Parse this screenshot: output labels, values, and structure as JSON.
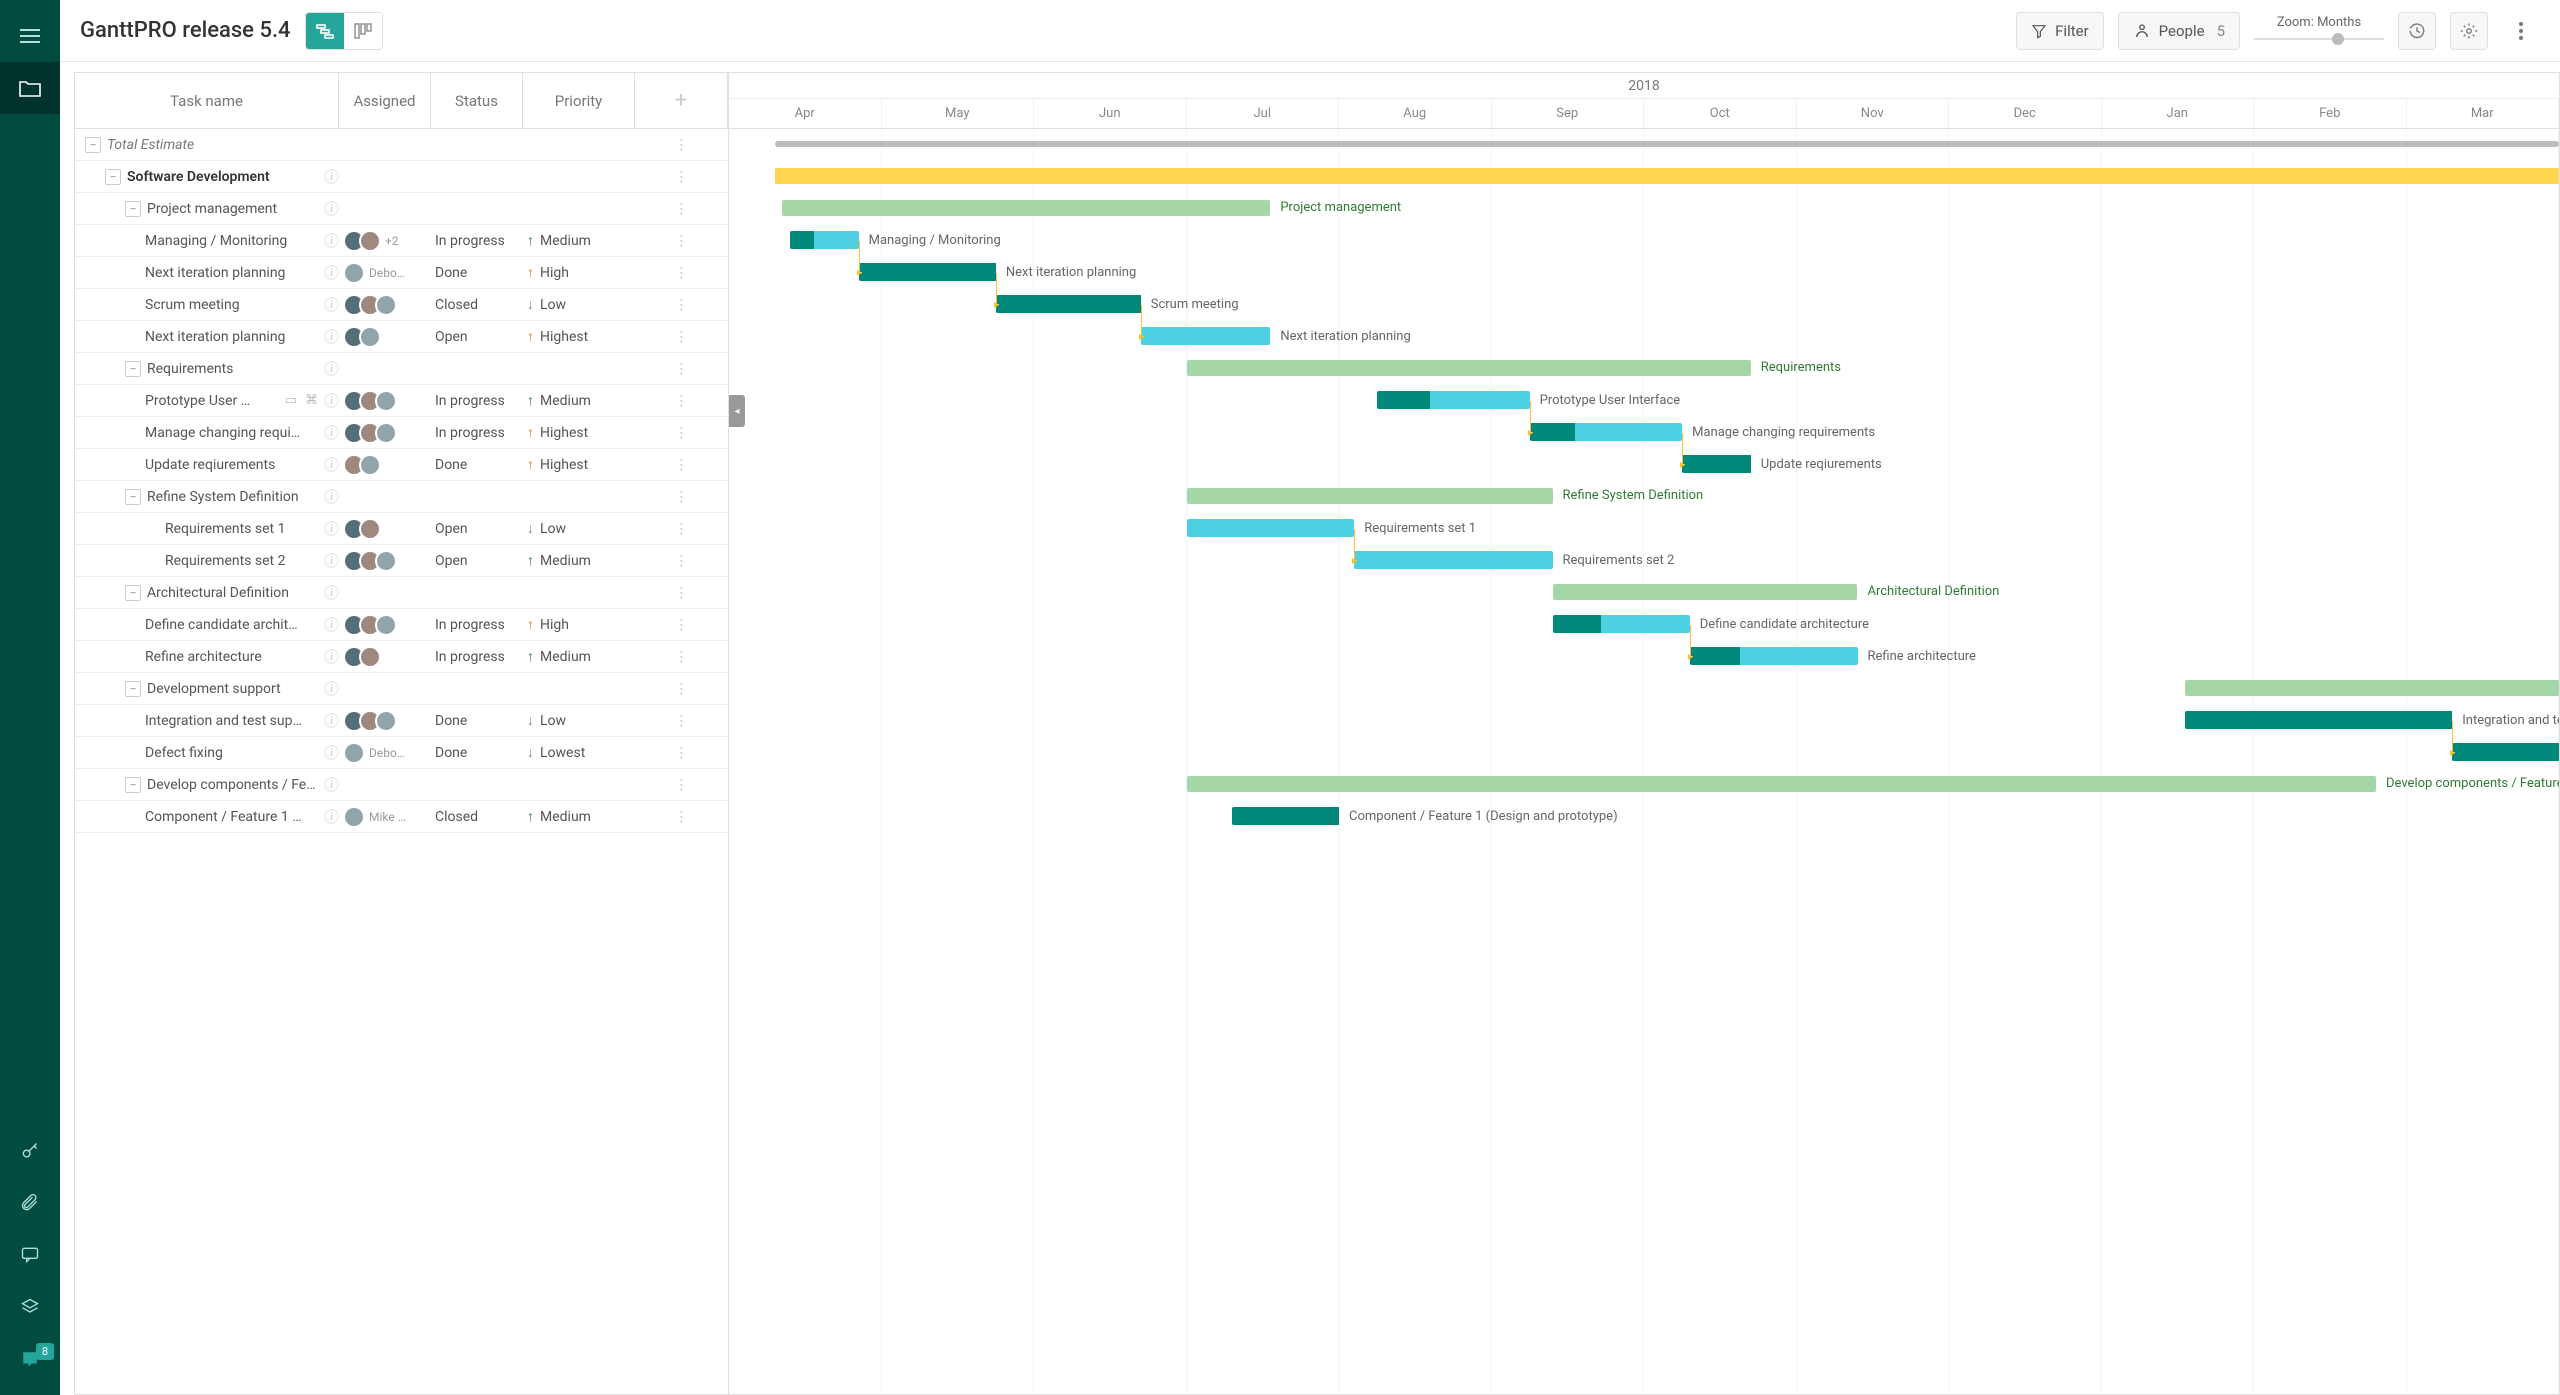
{
  "header": {
    "title": "GanttPRO release 5.4",
    "filter": "Filter",
    "people": "People",
    "people_count": "5",
    "zoom": "Zoom: Months"
  },
  "columns": {
    "task": "Task name",
    "assigned": "Assigned",
    "status": "Status",
    "priority": "Priority"
  },
  "timeline": {
    "year": "2018",
    "months": [
      "Apr",
      "May",
      "Jun",
      "Jul",
      "Aug",
      "Sep",
      "Oct",
      "Nov",
      "Dec",
      "Jan",
      "Feb",
      "Mar"
    ]
  },
  "badge_count": "8",
  "chart_data": {
    "type": "gantt",
    "title": "GanttPRO release 5.4",
    "x_unit": "month",
    "x_start": "2018-04",
    "x_end": "2019-03",
    "xticks": [
      "Apr",
      "May",
      "Jun",
      "Jul",
      "Aug",
      "Sep",
      "Oct",
      "Nov",
      "Dec",
      "Jan",
      "Feb",
      "Mar"
    ],
    "tasks": [
      {
        "id": "total",
        "name": "Total Estimate",
        "indent": 0,
        "type": "total",
        "start": 0.3,
        "end": 12.0
      },
      {
        "id": "sw",
        "name": "Software Development",
        "indent": 1,
        "type": "summary",
        "color": "orange",
        "start": 0.3,
        "end": 12.0
      },
      {
        "id": "pm",
        "name": "Project management",
        "indent": 2,
        "type": "summary",
        "start": 0.35,
        "end": 3.55
      },
      {
        "id": "t1",
        "name": "Managing / Monitoring",
        "indent": 3,
        "type": "task",
        "start": 0.4,
        "end": 0.85,
        "progress": 0.35,
        "status": "In progress",
        "priority": "Medium",
        "prio_dir": "up-green",
        "assigned": [
          1,
          2
        ],
        "assigned_extra": "+2"
      },
      {
        "id": "t2",
        "name": "Next iteration planning",
        "indent": 3,
        "type": "task",
        "start": 0.85,
        "end": 1.75,
        "progress": 1.0,
        "status": "Done",
        "priority": "High",
        "prio_dir": "up-orange",
        "assigned": [
          3
        ],
        "assigned_label": "Debo…",
        "depends": "t1"
      },
      {
        "id": "t3",
        "name": "Scrum meeting",
        "indent": 3,
        "type": "task",
        "start": 1.75,
        "end": 2.7,
        "progress": 1.0,
        "status": "Closed",
        "priority": "Low",
        "prio_dir": "down",
        "assigned": [
          1,
          2,
          3
        ],
        "depends": "t2"
      },
      {
        "id": "t4",
        "name": "Next iteration planning",
        "indent": 3,
        "type": "task",
        "start": 2.7,
        "end": 3.55,
        "progress": 0.0,
        "status": "Open",
        "priority": "Highest",
        "prio_dir": "up-orange",
        "assigned": [
          1,
          3
        ],
        "depends": "t3"
      },
      {
        "id": "req",
        "name": "Requirements",
        "indent": 2,
        "type": "summary",
        "start": 3.0,
        "end": 6.7
      },
      {
        "id": "t5",
        "name": "Prototype User Interface",
        "indent": 3,
        "type": "task",
        "display": "Prototype User …",
        "start": 4.25,
        "end": 5.25,
        "progress": 0.35,
        "status": "In progress",
        "priority": "Medium",
        "prio_dir": "up-green",
        "assigned": [
          1,
          2,
          3
        ],
        "has_note": true,
        "has_attach": true
      },
      {
        "id": "t6",
        "name": "Manage changing requirements",
        "indent": 3,
        "type": "task",
        "display": "Manage changing requi…",
        "start": 5.25,
        "end": 6.25,
        "progress": 0.3,
        "status": "In progress",
        "priority": "Highest",
        "prio_dir": "up-orange",
        "assigned": [
          1,
          2,
          3
        ],
        "depends": "t5"
      },
      {
        "id": "t7",
        "name": "Update reqiurements",
        "indent": 3,
        "type": "task",
        "start": 6.25,
        "end": 6.7,
        "progress": 1.0,
        "status": "Done",
        "priority": "Highest",
        "prio_dir": "up-orange",
        "assigned": [
          2,
          3
        ],
        "depends": "t6"
      },
      {
        "id": "rsd",
        "name": "Refine System Definition",
        "indent": 2,
        "type": "summary",
        "start": 3.0,
        "end": 5.4
      },
      {
        "id": "t8",
        "name": "Requirements set 1",
        "indent": 4,
        "type": "task",
        "start": 3.0,
        "end": 4.1,
        "progress": 0.0,
        "status": "Open",
        "priority": "Low",
        "prio_dir": "down",
        "assigned": [
          1,
          2
        ]
      },
      {
        "id": "t9",
        "name": "Requirements set 2",
        "indent": 4,
        "type": "task",
        "start": 4.1,
        "end": 5.4,
        "progress": 0.0,
        "status": "Open",
        "priority": "Medium",
        "prio_dir": "up-green",
        "assigned": [
          1,
          2,
          3
        ],
        "depends": "t8"
      },
      {
        "id": "arch",
        "name": "Architectural Definition",
        "indent": 2,
        "type": "summary",
        "start": 5.4,
        "end": 7.4
      },
      {
        "id": "t10",
        "name": "Define candidate architecture",
        "indent": 3,
        "type": "task",
        "display": "Define candidate archit…",
        "start": 5.4,
        "end": 6.3,
        "progress": 0.35,
        "status": "In progress",
        "priority": "High",
        "prio_dir": "up-orange",
        "assigned": [
          1,
          2,
          3
        ]
      },
      {
        "id": "t11",
        "name": "Refine architecture",
        "indent": 3,
        "type": "task",
        "start": 6.3,
        "end": 7.4,
        "progress": 0.3,
        "status": "In progress",
        "priority": "Medium",
        "prio_dir": "up-green",
        "assigned": [
          1,
          2
        ],
        "depends": "t10"
      },
      {
        "id": "dev",
        "name": "Development support",
        "indent": 2,
        "type": "summary",
        "start": 9.55,
        "end": 12.0
      },
      {
        "id": "t12",
        "name": "Integration and test support",
        "indent": 3,
        "type": "task",
        "display": "Integration and test sup…",
        "start": 9.55,
        "end": 11.3,
        "progress": 1.0,
        "status": "Done",
        "priority": "Low",
        "prio_dir": "down",
        "assigned": [
          1,
          2,
          3
        ],
        "label": "Integration and test"
      },
      {
        "id": "t13",
        "name": "Defect fixing",
        "indent": 3,
        "type": "task",
        "start": 11.3,
        "end": 12.0,
        "progress": 1.0,
        "status": "Done",
        "priority": "Lowest",
        "prio_dir": "down",
        "assigned": [
          3
        ],
        "assigned_label": "Debo…",
        "depends": "t12"
      },
      {
        "id": "comp",
        "name": "Develop components / Feature",
        "indent": 2,
        "type": "summary",
        "display": "Develop components / Fea…",
        "start": 3.0,
        "end": 10.8,
        "label": "Develop components / Feature"
      },
      {
        "id": "t14",
        "name": "Component / Feature 1 (Design and prototype)",
        "indent": 3,
        "type": "task",
        "display": "Component / Feature 1 …",
        "start": 3.3,
        "end": 4.0,
        "progress": 1.0,
        "status": "Closed",
        "priority": "Medium",
        "prio_dir": "up-green",
        "assigned": [
          3
        ],
        "assigned_label": "Mike …"
      }
    ]
  }
}
